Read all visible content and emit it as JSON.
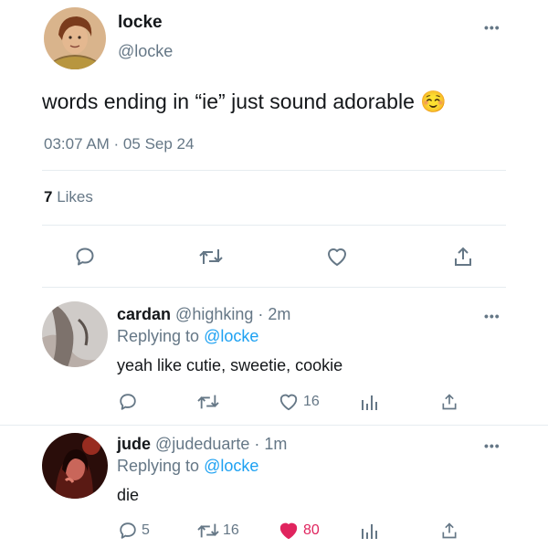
{
  "main_tweet": {
    "display_name": "locke",
    "handle": "@locke",
    "text": "words ending in “ie” just sound adorable ☺️",
    "timestamp": "03:07 AM · 05 Sep 24",
    "likes_count": "7",
    "likes_label": "Likes",
    "avatar": {
      "bg": "#caa27a",
      "hair": "#7a3b1c",
      "skin": "#e2b48c"
    }
  },
  "replies": [
    {
      "display_name": "cardan",
      "handle": "@highking",
      "age": "· 2m",
      "replying_to_label": "Replying to",
      "replying_to_handle": "@locke",
      "text": "yeah like cutie, sweetie, cookie",
      "counts": {
        "reply": "",
        "retweet": "",
        "like": "16"
      },
      "liked": false,
      "avatar": {
        "bg": "#d8d8d8",
        "skin": "#bfb6b0",
        "dark": "#6b6460"
      }
    },
    {
      "display_name": "jude",
      "handle": "@judeduarte",
      "age": "· 1m",
      "replying_to_label": "Replying to",
      "replying_to_handle": "@locke",
      "text": "die",
      "counts": {
        "reply": "5",
        "retweet": "16",
        "like": "80"
      },
      "liked": true,
      "avatar": {
        "bg": "#2a0d0a",
        "skin": "#c9665a",
        "dark": "#5a1a14"
      }
    }
  ],
  "colors": {
    "accent": "#1da1f2",
    "muted": "#657786",
    "like_active": "#e0245e",
    "divider": "#e6ecf0"
  }
}
